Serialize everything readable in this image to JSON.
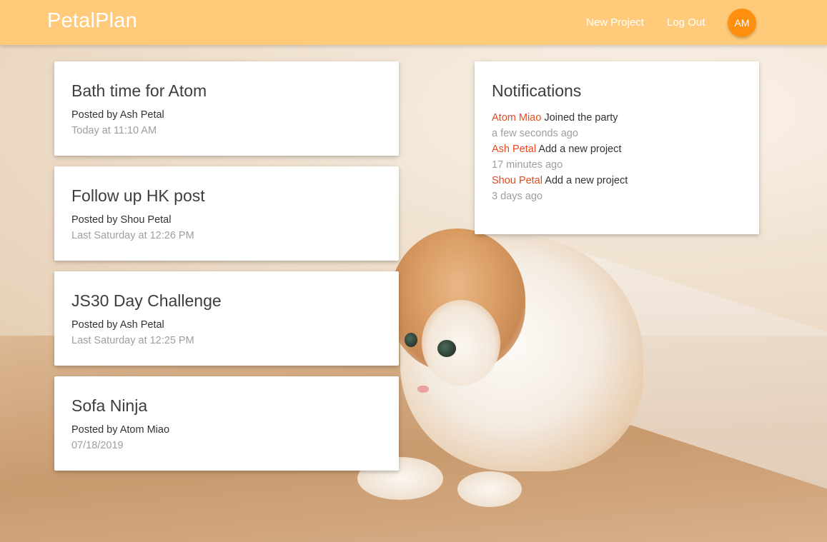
{
  "navbar": {
    "brand": "PetalPlan",
    "links": {
      "new_project": "New Project",
      "log_out": "Log Out"
    },
    "avatar_initials": "AM",
    "background_color": "#ffca7a",
    "avatar_color": "#ff8f0e"
  },
  "projects": [
    {
      "title": "Bath time for Atom",
      "author": "Posted by Ash Petal",
      "date": "Today at 11:10 AM"
    },
    {
      "title": "Follow up HK post",
      "author": "Posted by Shou Petal",
      "date": "Last Saturday at 12:26 PM"
    },
    {
      "title": "JS30 Day Challenge",
      "author": "Posted by Ash Petal",
      "date": "Last Saturday at 12:25 PM"
    },
    {
      "title": "Sofa Ninja",
      "author": "Posted by Atom Miao",
      "date": "07/18/2019"
    }
  ],
  "notifications": {
    "heading": "Notifications",
    "items": [
      {
        "user": "Atom Miao",
        "action": "Joined the party",
        "time": "a few seconds ago"
      },
      {
        "user": "Ash Petal",
        "action": "Add a new project",
        "time": "17 minutes ago"
      },
      {
        "user": "Shou Petal",
        "action": "Add a new project",
        "time": "3 days ago"
      }
    ],
    "user_color": "#e8491d"
  },
  "background": {
    "image": "kitten-photo"
  }
}
